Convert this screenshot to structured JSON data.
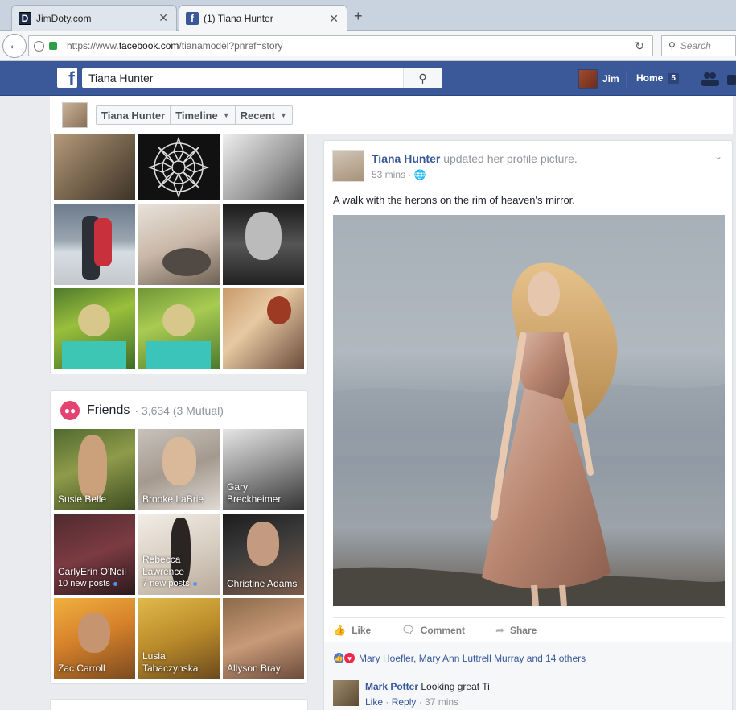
{
  "browser": {
    "tabs": [
      {
        "title": "JimDoty.com",
        "favicon": "D"
      },
      {
        "title": "(1) Tiana Hunter",
        "favicon": "f"
      }
    ],
    "url_prefix": "https://www.",
    "url_host": "facebook.com",
    "url_path": "/tianamodel?pnref=story",
    "search_placeholder": "Search"
  },
  "fb": {
    "search_value": "Tiana Hunter",
    "user_name": "Jim",
    "home_label": "Home",
    "home_count": "5"
  },
  "profile_header": {
    "name_pill": "Tiana Hunter",
    "timeline_pill": "Timeline",
    "recent_pill": "Recent"
  },
  "friends": {
    "title": "Friends",
    "count": "· 3,634 (3 Mutual)",
    "people": [
      {
        "name": "Susie Belle",
        "sub": ""
      },
      {
        "name": "Brooke LaBrie",
        "sub": ""
      },
      {
        "name": "Gary Breckheimer",
        "sub": ""
      },
      {
        "name": "CarlyErin O'Neil",
        "sub": "10 new posts"
      },
      {
        "name": "Rebecca Lawrence",
        "sub": "7 new posts"
      },
      {
        "name": "Christine Adams",
        "sub": ""
      },
      {
        "name": "Zac Carroll",
        "sub": ""
      },
      {
        "name": "Lusia Tabaczynska",
        "sub": ""
      },
      {
        "name": "Allyson Bray",
        "sub": ""
      }
    ]
  },
  "post": {
    "author": "Tiana Hunter",
    "action": "updated her profile picture.",
    "time": "53 mins · ",
    "text": "A walk with the herons on the rim of heaven's mirror.",
    "like_label": "Like",
    "comment_label": "Comment",
    "share_label": "Share",
    "reactions": "Mary Hoefler, Mary Ann Luttrell Murray and 14 others",
    "comment": {
      "author": "Mark Potter",
      "text": " Looking great Ti",
      "like": "Like",
      "reply": "Reply",
      "time": " · 37 mins"
    }
  },
  "colors": {
    "fb_blue": "#3b5998",
    "link": "#365899",
    "friends_icon": "#e4426f"
  }
}
